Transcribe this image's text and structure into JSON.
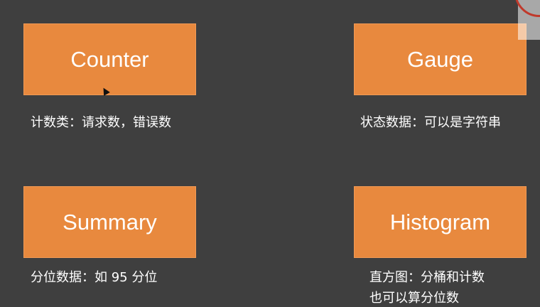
{
  "cards": [
    {
      "title": "Counter",
      "caption": "计数类：请求数，错误数"
    },
    {
      "title": "Gauge",
      "caption": "状态数据：可以是字符串"
    },
    {
      "title": "Summary",
      "caption": "分位数据：如 95 分位"
    },
    {
      "title": "Histogram",
      "caption_lines": [
        "直方图：分桶和计数",
        "也可以算分位数"
      ]
    }
  ],
  "colors": {
    "background": "#3f3f3f",
    "card": "#e8893e",
    "text": "#ffffff"
  }
}
